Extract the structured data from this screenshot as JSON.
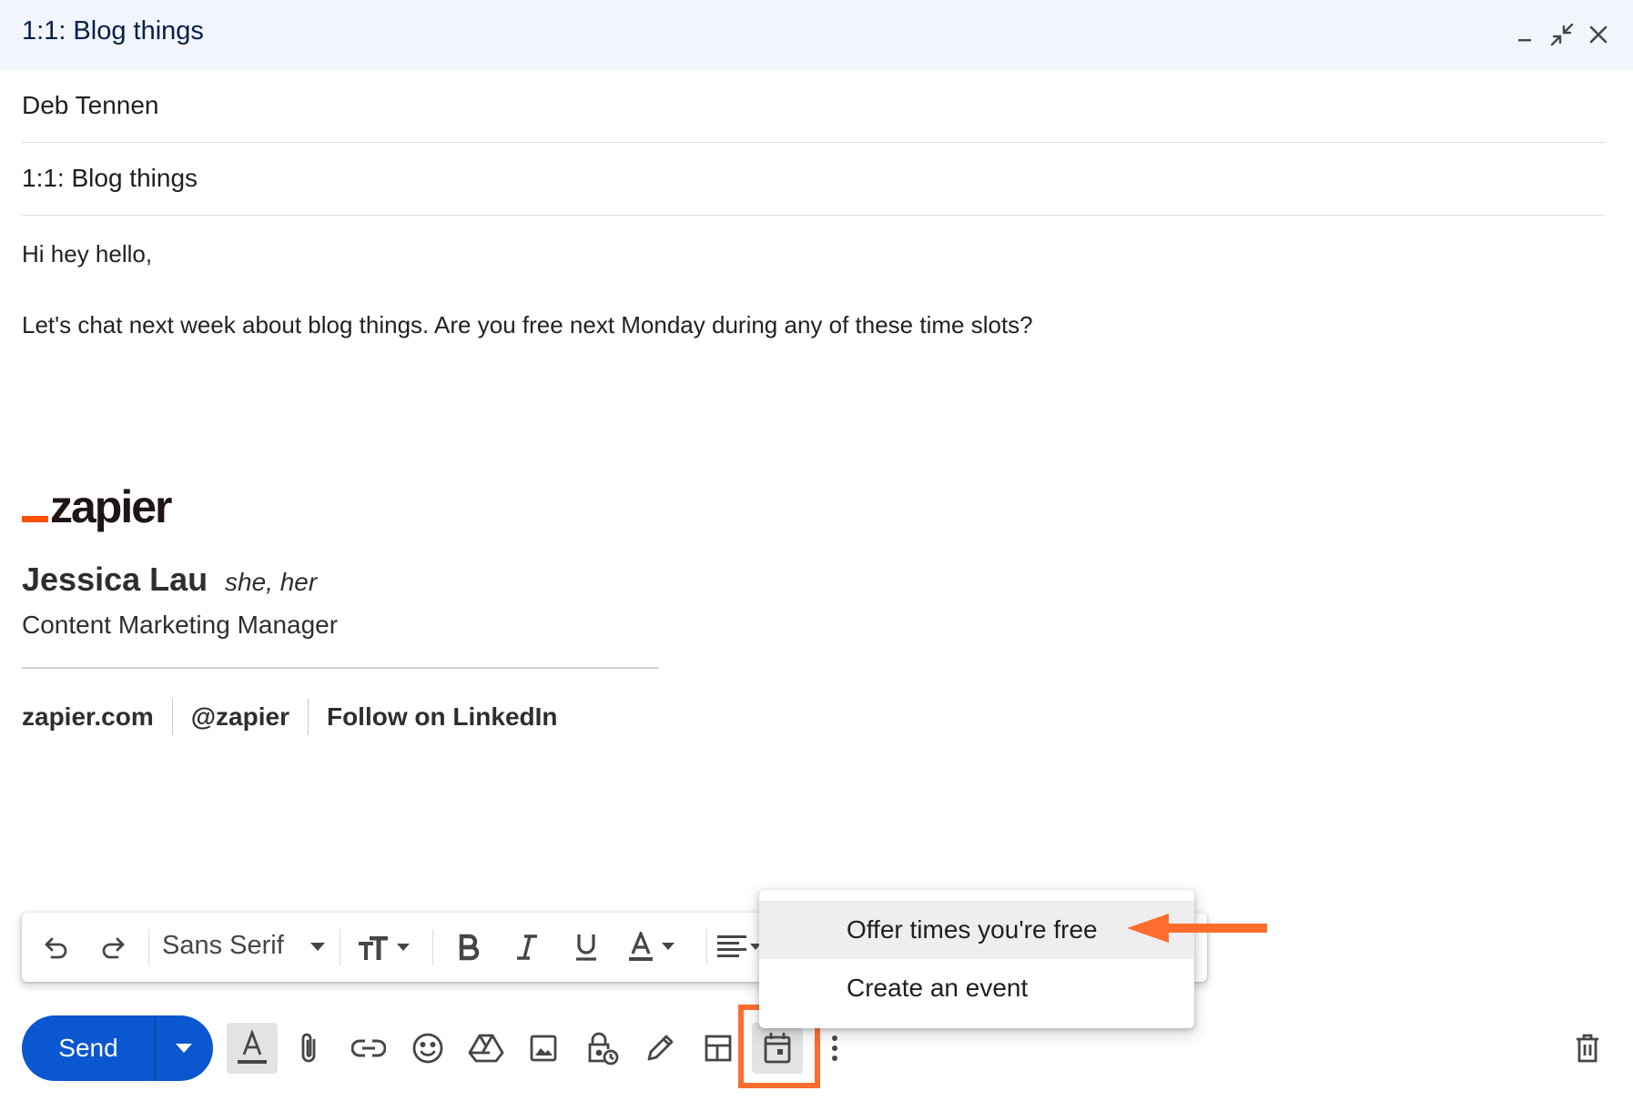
{
  "window": {
    "title": "1:1: Blog things"
  },
  "compose": {
    "to": "Deb Tennen",
    "subject": "1:1: Blog things",
    "body_lines": [
      "Hi hey hello,",
      "Let's chat next week about blog things. Are you free next Monday during any of these time slots?"
    ]
  },
  "signature": {
    "logo_text": "zapier",
    "name": "Jessica Lau",
    "pronouns": "she, her",
    "role": "Content Marketing Manager",
    "links": [
      "zapier.com",
      "@zapier",
      "Follow on LinkedIn"
    ]
  },
  "format_toolbar": {
    "font": "Sans Serif"
  },
  "actions": {
    "send_label": "Send"
  },
  "schedule_menu": {
    "items": [
      "Offer times you're free",
      "Create an event"
    ],
    "hovered_index": 0
  },
  "colors": {
    "accent": "#0b57d0",
    "title_bar": "#f2f6fc",
    "callout": "#ff6d2e",
    "brand": "#ff4f00"
  },
  "icons": {
    "window": [
      "minimize-icon",
      "exit-fullscreen-icon",
      "close-icon"
    ],
    "format": [
      "undo-icon",
      "redo-icon",
      "font-size-icon",
      "bold-icon",
      "italic-icon",
      "underline-icon",
      "text-color-icon",
      "align-icon"
    ],
    "actions": [
      "formatting-options-icon",
      "attach-icon",
      "link-icon",
      "emoji-icon",
      "drive-icon",
      "photo-icon",
      "confidential-icon",
      "signature-icon",
      "layouts-icon",
      "calendar-icon",
      "more-options-icon",
      "trash-icon"
    ]
  }
}
